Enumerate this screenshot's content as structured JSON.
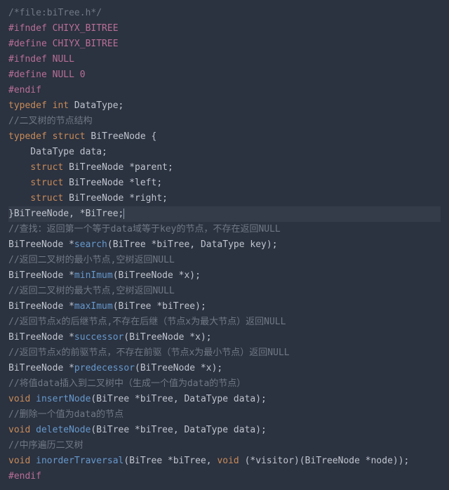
{
  "code": {
    "lines": [
      {
        "class": "c-comment",
        "text": "/*file:biTree.h*/"
      },
      {
        "class": "c-kw",
        "text": "#ifndef CHIYX_BITREE"
      },
      {
        "class": "c-kw",
        "text": "#define CHIYX_BITREE"
      },
      {
        "class": "c-kw",
        "text": "#ifndef NULL"
      },
      {
        "class": "c-kw",
        "text": "#define NULL 0"
      },
      {
        "class": "c-kw",
        "text": "#endif"
      },
      {
        "segments": [
          {
            "class": "c-type",
            "text": "typedef"
          },
          {
            "text": " "
          },
          {
            "class": "c-type",
            "text": "int"
          },
          {
            "text": " DataType;"
          }
        ]
      },
      {
        "class": "c-comment",
        "text": "//二叉树的节点结构"
      },
      {
        "segments": [
          {
            "class": "c-type",
            "text": "typedef"
          },
          {
            "text": " "
          },
          {
            "class": "c-type",
            "text": "struct"
          },
          {
            "text": " BiTreeNode {"
          }
        ]
      },
      {
        "text": "    DataType data;"
      },
      {
        "segments": [
          {
            "text": "    "
          },
          {
            "class": "c-type",
            "text": "struct"
          },
          {
            "text": " BiTreeNode *parent;"
          }
        ]
      },
      {
        "segments": [
          {
            "text": "    "
          },
          {
            "class": "c-type",
            "text": "struct"
          },
          {
            "text": " BiTreeNode *left;"
          }
        ]
      },
      {
        "segments": [
          {
            "text": "    "
          },
          {
            "class": "c-type",
            "text": "struct"
          },
          {
            "text": " BiTreeNode *right;"
          }
        ]
      },
      {
        "segments": [
          {
            "text": "}BiTreeNode, *BiTree;"
          },
          {
            "class": "cursor",
            "text": ""
          }
        ],
        "hl": true
      },
      {
        "class": "c-comment",
        "text": "//查找：返回第一个等于data域等于key的节点，不存在返回NULL"
      },
      {
        "segments": [
          {
            "text": "BiTreeNode *"
          },
          {
            "class": "c-func",
            "text": "search"
          },
          {
            "text": "(BiTree *biTree, DataType key);"
          }
        ]
      },
      {
        "class": "c-comment",
        "text": "//返回二叉树的最小节点,空树返回NULL"
      },
      {
        "segments": [
          {
            "text": "BiTreeNode *"
          },
          {
            "class": "c-func",
            "text": "minImum"
          },
          {
            "text": "(BiTreeNode *x);"
          }
        ]
      },
      {
        "class": "c-comment",
        "text": "//返回二叉树的最大节点,空树返回NULL"
      },
      {
        "segments": [
          {
            "text": "BiTreeNode *"
          },
          {
            "class": "c-func",
            "text": "maxImum"
          },
          {
            "text": "(BiTree *biTree);"
          }
        ]
      },
      {
        "class": "c-comment",
        "text": "//返回节点x的后继节点,不存在后继（节点x为最大节点）返回NULL"
      },
      {
        "segments": [
          {
            "text": "BiTreeNode *"
          },
          {
            "class": "c-func",
            "text": "successor"
          },
          {
            "text": "(BiTreeNode *x);"
          }
        ]
      },
      {
        "class": "c-comment",
        "text": "//返回节点x的前驱节点，不存在前驱（节点x为最小节点）返回NULL"
      },
      {
        "segments": [
          {
            "text": "BiTreeNode *"
          },
          {
            "class": "c-func",
            "text": "predecessor"
          },
          {
            "text": "(BiTreeNode *x);"
          }
        ]
      },
      {
        "class": "c-comment",
        "text": "//将值data插入到二叉树中（生成一个值为data的节点）"
      },
      {
        "segments": [
          {
            "class": "c-type",
            "text": "void"
          },
          {
            "text": " "
          },
          {
            "class": "c-func",
            "text": "insertNode"
          },
          {
            "text": "(BiTree *biTree, DataType data);"
          }
        ]
      },
      {
        "class": "c-comment",
        "text": "//删除一个值为data的节点"
      },
      {
        "segments": [
          {
            "class": "c-type",
            "text": "void"
          },
          {
            "text": " "
          },
          {
            "class": "c-func",
            "text": "deleteNode"
          },
          {
            "text": "(BiTree *biTree, DataType data);"
          }
        ]
      },
      {
        "class": "c-comment",
        "text": "//中序遍历二叉树"
      },
      {
        "segments": [
          {
            "class": "c-type",
            "text": "void"
          },
          {
            "text": " "
          },
          {
            "class": "c-func",
            "text": "inorderTraversal"
          },
          {
            "text": "(BiTree *biTree, "
          },
          {
            "class": "c-type",
            "text": "void"
          },
          {
            "text": " (*visitor)(BiTreeNode *node));"
          }
        ]
      },
      {
        "class": "c-kw",
        "text": "#endif"
      }
    ]
  }
}
